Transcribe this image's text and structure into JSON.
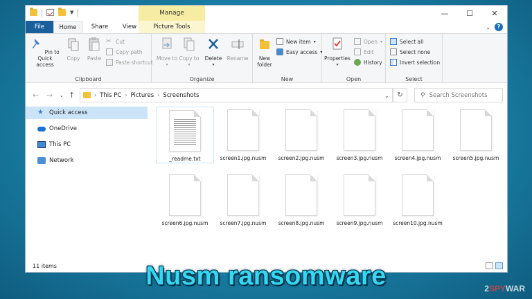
{
  "titlebar": {
    "manage_label": "Manage",
    "minimize": "—",
    "maximize": "☐",
    "close": "✕"
  },
  "tabs": {
    "file": "File",
    "home": "Home",
    "share": "Share",
    "view": "View",
    "picture_tools": "Picture Tools"
  },
  "ribbon": {
    "clipboard": {
      "label": "Clipboard",
      "pin": "Pin to Quick access",
      "copy": "Copy",
      "paste": "Paste",
      "cut": "Cut",
      "copy_path": "Copy path",
      "paste_shortcut": "Paste shortcut"
    },
    "organize": {
      "label": "Organize",
      "move_to": "Move to",
      "copy_to": "Copy to",
      "delete": "Delete",
      "rename": "Rename"
    },
    "new": {
      "label": "New",
      "new_folder": "New folder",
      "new_item": "New item",
      "easy_access": "Easy access"
    },
    "open": {
      "label": "Open",
      "properties": "Properties",
      "open": "Open",
      "edit": "Edit",
      "history": "History"
    },
    "select": {
      "label": "Select",
      "select_all": "Select all",
      "select_none": "Select none",
      "invert": "Invert selection"
    }
  },
  "address": {
    "crumbs": [
      "This PC",
      "Pictures",
      "Screenshots"
    ],
    "search_placeholder": "Search Screenshots"
  },
  "navpane": {
    "items": [
      "Quick access",
      "OneDrive",
      "This PC",
      "Network"
    ]
  },
  "files": [
    {
      "name": "_readme.txt",
      "type": "txt"
    },
    {
      "name": "screen1.jpg.nusm",
      "type": "blank"
    },
    {
      "name": "screen2.jpg.nusm",
      "type": "blank"
    },
    {
      "name": "screen3.jpg.nusm",
      "type": "blank"
    },
    {
      "name": "screen4.jpg.nusm",
      "type": "blank"
    },
    {
      "name": "screen5.jpg.nusm",
      "type": "blank"
    },
    {
      "name": "screen6.jpg.nusm",
      "type": "blank"
    },
    {
      "name": "screen7.jpg.nusm",
      "type": "blank"
    },
    {
      "name": "screen8.jpg.nusm",
      "type": "blank"
    },
    {
      "name": "screen9.jpg.nusm",
      "type": "blank"
    },
    {
      "name": "screen10.jpg.nusm",
      "type": "blank"
    }
  ],
  "status": {
    "count": "11 items"
  },
  "caption": "Nusm ransomware",
  "watermark": {
    "prefix": "2",
    "red": "SPY",
    "suffix": "WAR"
  },
  "colors": {
    "accent": "#1a5f9c",
    "manage_tab": "#f6eda2",
    "selection": "#cce4f7",
    "caption": "#35d8f0"
  }
}
